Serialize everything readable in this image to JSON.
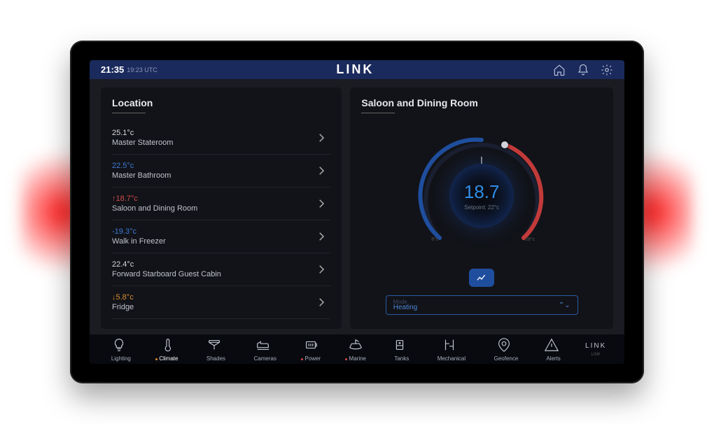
{
  "header": {
    "time": "21:35",
    "tz": "19:23 UTC",
    "title": "LINK"
  },
  "location_panel": {
    "title": "Location",
    "rows": [
      {
        "temp": "25.1°c",
        "name": "Master Stateroom",
        "color": "t-white",
        "arrow": ""
      },
      {
        "temp": "22.5°c",
        "name": "Master Bathroom",
        "color": "t-blue",
        "arrow": ""
      },
      {
        "temp": "18.7°c",
        "name": "Saloon and Dining Room",
        "color": "t-red",
        "arrow": "arrow-up"
      },
      {
        "temp": "-19.3°c",
        "name": "Walk in Freezer",
        "color": "t-blue",
        "arrow": ""
      },
      {
        "temp": "22.4°c",
        "name": "Forward Starboard Guest Cabin",
        "color": "t-white",
        "arrow": ""
      },
      {
        "temp": "5.8°c",
        "name": "Fridge",
        "color": "t-orange",
        "arrow": "arrow-down"
      }
    ]
  },
  "detail_panel": {
    "title": "Saloon and Dining Room",
    "value": "18.7",
    "setpoint_label": "Setpoint: 22°c",
    "min_label": "8°c",
    "max_label": "28°c",
    "mode_title": "Mode",
    "mode_value": "Heating"
  },
  "nav": {
    "items": [
      {
        "label": "Lighting",
        "icon": "bulb",
        "state": ""
      },
      {
        "label": "Climate",
        "icon": "thermo",
        "state": "active"
      },
      {
        "label": "Shades",
        "icon": "shade",
        "state": ""
      },
      {
        "label": "Cameras",
        "icon": "camera",
        "state": ""
      },
      {
        "label": "Power",
        "icon": "battery",
        "state": "alert"
      },
      {
        "label": "Marine",
        "icon": "boat",
        "state": "alert"
      },
      {
        "label": "Tanks",
        "icon": "tank",
        "state": ""
      },
      {
        "label": "Mechanical",
        "icon": "mech",
        "state": ""
      },
      {
        "label": "Geofence",
        "icon": "geo",
        "state": ""
      },
      {
        "label": "Alerts",
        "icon": "alerts",
        "state": ""
      }
    ],
    "brand": "LINK",
    "brand_sub": "LINK"
  }
}
